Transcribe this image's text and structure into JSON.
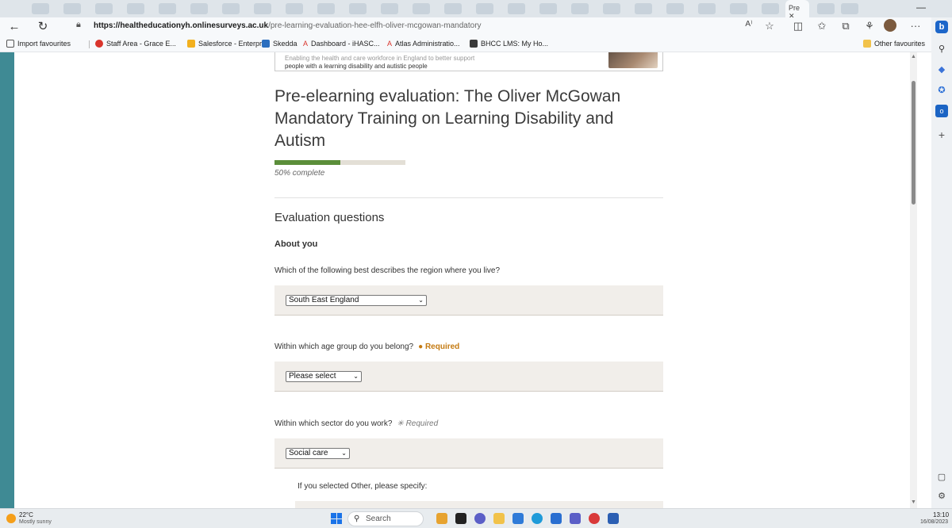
{
  "browser": {
    "active_tab_label": "Pre",
    "url_host": "https://healtheducationyh.onlinesurveys.ac.uk",
    "url_path": "/pre-learning-evaluation-hee-elfh-oliver-mcgowan-mandatory",
    "read_aloud_label": "A⁾",
    "more_label": "···"
  },
  "favourites": {
    "import": "Import favourites",
    "items": [
      {
        "label": "Staff Area - Grace E...",
        "color": "#d9352c"
      },
      {
        "label": "Salesforce - Enterpr...",
        "color": "#f2b01e"
      },
      {
        "label": "Skedda",
        "color": "#2c6fbf"
      },
      {
        "label": "Dashboard - iHASC...",
        "color": "#d9352c"
      },
      {
        "label": "Atlas Administratio...",
        "color": "#d9352c"
      },
      {
        "label": "BHCC LMS: My Ho...",
        "color": "#3a3a3a"
      }
    ],
    "other": "Other favourites"
  },
  "banner": {
    "line1": "Enabling the health and care workforce in England to better support",
    "line2": "people with a learning disability and autistic people"
  },
  "page": {
    "title": "Pre-elearning evaluation: The Oliver McGowan Mandatory Training on Learning Disability and Autism",
    "progress_fraction": 0.5,
    "progress_text": "50% complete",
    "section": "Evaluation questions",
    "subhead": "About you"
  },
  "questions": {
    "q1": {
      "text": "Which of the following best describes the region where you live?",
      "value": "South East England"
    },
    "q2": {
      "text": "Within which age group do you belong?",
      "required": "● Required",
      "value": "Please select"
    },
    "q3": {
      "text": "Within which sector do you work?",
      "required": "✳ Required",
      "value": "Social care"
    },
    "other": {
      "text": "If you selected Other, please specify:"
    }
  },
  "taskbar": {
    "temp": "22°C",
    "weather": "Mostly sunny",
    "search": "Search",
    "time": "13:10",
    "date": "16/08/2023"
  },
  "colors": {
    "progress": "#5b8e3a",
    "required": "#c47a11",
    "accent": "#3f8a94"
  }
}
